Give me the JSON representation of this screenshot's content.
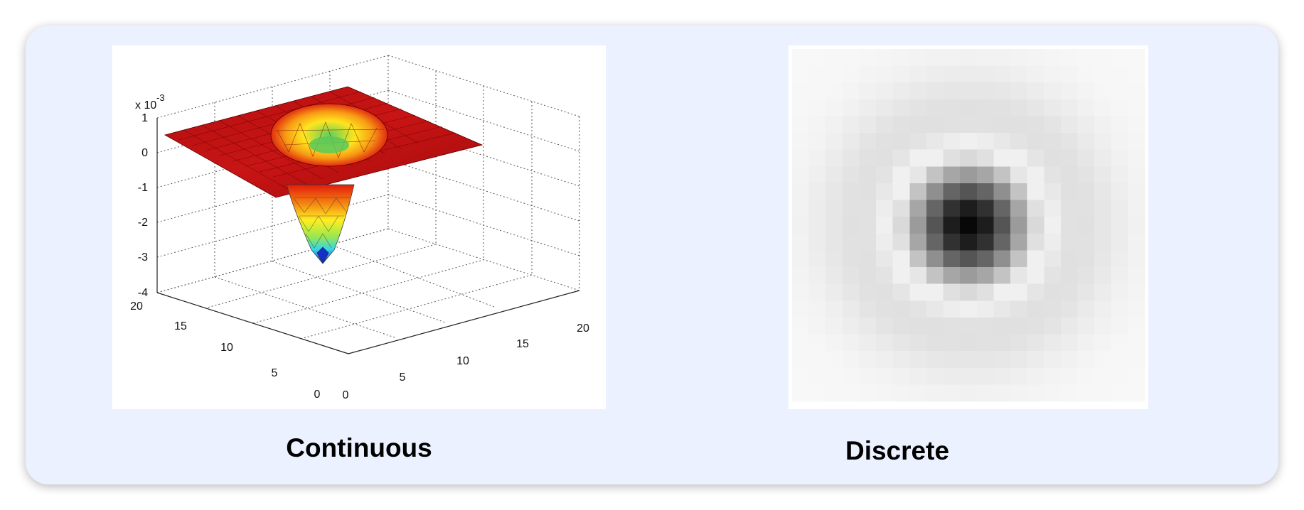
{
  "panels": [
    {
      "caption": "Continuous",
      "z_multiplier": "x 10",
      "z_exponent": "-3",
      "z_ticks": [
        "1",
        "0",
        "-1",
        "-2",
        "-3",
        "-4"
      ],
      "x_ticks": [
        "0",
        "5",
        "10",
        "15",
        "20"
      ],
      "y_ticks": [
        "0",
        "5",
        "10",
        "15",
        "20"
      ]
    },
    {
      "caption": "Discrete"
    }
  ]
}
